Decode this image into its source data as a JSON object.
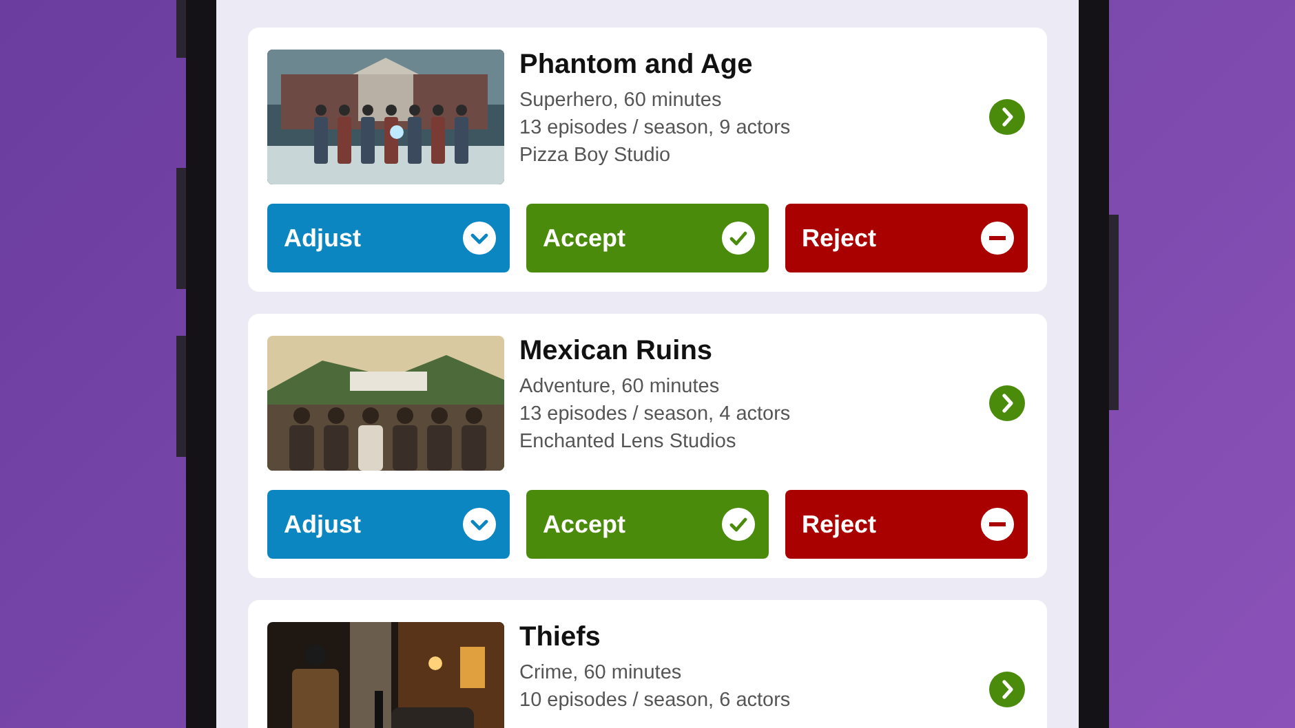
{
  "shows": [
    {
      "kind": "picture",
      "title": "Phantom and Age",
      "lines": [
        "Superhero, 60 minutes",
        "13 episodes / season, 9 actors",
        "Pizza Boy Studio"
      ],
      "actions": [
        {
          "kind": "adjust",
          "label": "Adjust"
        },
        {
          "kind": "accept",
          "label": "Accept"
        },
        {
          "kind": "reject",
          "label": "Reject"
        }
      ]
    },
    {
      "kind": "picture",
      "title": "Mexican Ruins",
      "lines": [
        "Adventure, 60 minutes",
        "13 episodes / season, 4 actors",
        "Enchanted Lens Studios"
      ],
      "actions": [
        {
          "kind": "adjust",
          "label": "Adjust"
        },
        {
          "kind": "accept",
          "label": "Accept"
        },
        {
          "kind": "reject",
          "label": "Reject"
        }
      ]
    },
    {
      "kind": "picture",
      "title": "Thiefs",
      "lines": [
        "Crime, 60 minutes",
        "10 episodes / season, 6 actors"
      ]
    }
  ]
}
